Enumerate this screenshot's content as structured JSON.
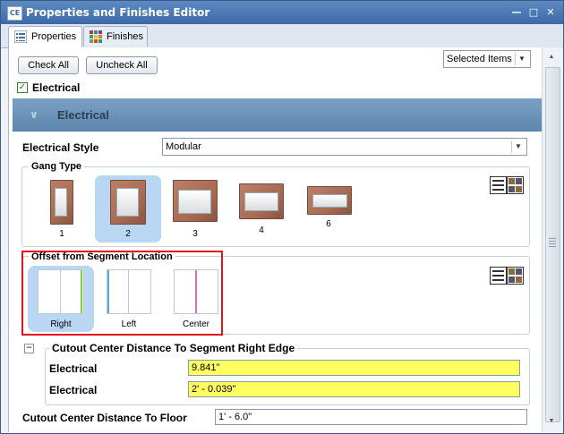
{
  "window": {
    "title": "Properties and Finishes Editor",
    "app_icon": "CE"
  },
  "tabs": [
    {
      "label": "Properties",
      "icon": "properties-list-icon",
      "active": true
    },
    {
      "label": "Finishes",
      "icon": "finishes-grid-icon",
      "active": false
    }
  ],
  "toolbar": {
    "check_all": "Check All",
    "uncheck_all": "Uncheck All",
    "scope": "Selected Items"
  },
  "filter": {
    "electrical_label": "Electrical",
    "checked": true
  },
  "section": {
    "title": "Electrical"
  },
  "electrical_style": {
    "label": "Electrical Style",
    "value": "Modular"
  },
  "gang_type": {
    "title": "Gang Type",
    "options": [
      "1",
      "2",
      "3",
      "4",
      "6"
    ],
    "selected": "2"
  },
  "offset": {
    "title": "Offset from Segment Location",
    "options": [
      "Right",
      "Left",
      "Center"
    ],
    "selected": "Right"
  },
  "cutout_right": {
    "title": "Cutout Center Distance To Segment Right Edge",
    "rows": [
      {
        "label": "Electrical",
        "value": "9.841\""
      },
      {
        "label": "Electrical",
        "value": "2' - 0.039\""
      }
    ]
  },
  "cutout_floor": {
    "label": "Cutout Center Distance To Floor",
    "value": "1' - 6.0\""
  },
  "colors": {
    "highlight": "#ffff60",
    "selection": "#b9d7f3",
    "annotation": "#e3141a"
  }
}
